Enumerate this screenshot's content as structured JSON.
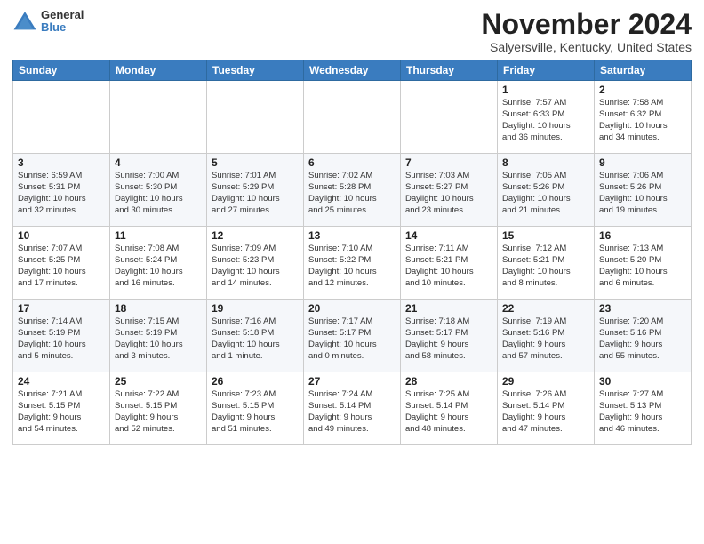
{
  "header": {
    "logo": {
      "general": "General",
      "blue": "Blue"
    },
    "title": "November 2024",
    "location": "Salyersville, Kentucky, United States"
  },
  "days_of_week": [
    "Sunday",
    "Monday",
    "Tuesday",
    "Wednesday",
    "Thursday",
    "Friday",
    "Saturday"
  ],
  "weeks": [
    [
      {
        "day": "",
        "info": ""
      },
      {
        "day": "",
        "info": ""
      },
      {
        "day": "",
        "info": ""
      },
      {
        "day": "",
        "info": ""
      },
      {
        "day": "",
        "info": ""
      },
      {
        "day": "1",
        "info": "Sunrise: 7:57 AM\nSunset: 6:33 PM\nDaylight: 10 hours\nand 36 minutes."
      },
      {
        "day": "2",
        "info": "Sunrise: 7:58 AM\nSunset: 6:32 PM\nDaylight: 10 hours\nand 34 minutes."
      }
    ],
    [
      {
        "day": "3",
        "info": "Sunrise: 6:59 AM\nSunset: 5:31 PM\nDaylight: 10 hours\nand 32 minutes."
      },
      {
        "day": "4",
        "info": "Sunrise: 7:00 AM\nSunset: 5:30 PM\nDaylight: 10 hours\nand 30 minutes."
      },
      {
        "day": "5",
        "info": "Sunrise: 7:01 AM\nSunset: 5:29 PM\nDaylight: 10 hours\nand 27 minutes."
      },
      {
        "day": "6",
        "info": "Sunrise: 7:02 AM\nSunset: 5:28 PM\nDaylight: 10 hours\nand 25 minutes."
      },
      {
        "day": "7",
        "info": "Sunrise: 7:03 AM\nSunset: 5:27 PM\nDaylight: 10 hours\nand 23 minutes."
      },
      {
        "day": "8",
        "info": "Sunrise: 7:05 AM\nSunset: 5:26 PM\nDaylight: 10 hours\nand 21 minutes."
      },
      {
        "day": "9",
        "info": "Sunrise: 7:06 AM\nSunset: 5:26 PM\nDaylight: 10 hours\nand 19 minutes."
      }
    ],
    [
      {
        "day": "10",
        "info": "Sunrise: 7:07 AM\nSunset: 5:25 PM\nDaylight: 10 hours\nand 17 minutes."
      },
      {
        "day": "11",
        "info": "Sunrise: 7:08 AM\nSunset: 5:24 PM\nDaylight: 10 hours\nand 16 minutes."
      },
      {
        "day": "12",
        "info": "Sunrise: 7:09 AM\nSunset: 5:23 PM\nDaylight: 10 hours\nand 14 minutes."
      },
      {
        "day": "13",
        "info": "Sunrise: 7:10 AM\nSunset: 5:22 PM\nDaylight: 10 hours\nand 12 minutes."
      },
      {
        "day": "14",
        "info": "Sunrise: 7:11 AM\nSunset: 5:21 PM\nDaylight: 10 hours\nand 10 minutes."
      },
      {
        "day": "15",
        "info": "Sunrise: 7:12 AM\nSunset: 5:21 PM\nDaylight: 10 hours\nand 8 minutes."
      },
      {
        "day": "16",
        "info": "Sunrise: 7:13 AM\nSunset: 5:20 PM\nDaylight: 10 hours\nand 6 minutes."
      }
    ],
    [
      {
        "day": "17",
        "info": "Sunrise: 7:14 AM\nSunset: 5:19 PM\nDaylight: 10 hours\nand 5 minutes."
      },
      {
        "day": "18",
        "info": "Sunrise: 7:15 AM\nSunset: 5:19 PM\nDaylight: 10 hours\nand 3 minutes."
      },
      {
        "day": "19",
        "info": "Sunrise: 7:16 AM\nSunset: 5:18 PM\nDaylight: 10 hours\nand 1 minute."
      },
      {
        "day": "20",
        "info": "Sunrise: 7:17 AM\nSunset: 5:17 PM\nDaylight: 10 hours\nand 0 minutes."
      },
      {
        "day": "21",
        "info": "Sunrise: 7:18 AM\nSunset: 5:17 PM\nDaylight: 9 hours\nand 58 minutes."
      },
      {
        "day": "22",
        "info": "Sunrise: 7:19 AM\nSunset: 5:16 PM\nDaylight: 9 hours\nand 57 minutes."
      },
      {
        "day": "23",
        "info": "Sunrise: 7:20 AM\nSunset: 5:16 PM\nDaylight: 9 hours\nand 55 minutes."
      }
    ],
    [
      {
        "day": "24",
        "info": "Sunrise: 7:21 AM\nSunset: 5:15 PM\nDaylight: 9 hours\nand 54 minutes."
      },
      {
        "day": "25",
        "info": "Sunrise: 7:22 AM\nSunset: 5:15 PM\nDaylight: 9 hours\nand 52 minutes."
      },
      {
        "day": "26",
        "info": "Sunrise: 7:23 AM\nSunset: 5:15 PM\nDaylight: 9 hours\nand 51 minutes."
      },
      {
        "day": "27",
        "info": "Sunrise: 7:24 AM\nSunset: 5:14 PM\nDaylight: 9 hours\nand 49 minutes."
      },
      {
        "day": "28",
        "info": "Sunrise: 7:25 AM\nSunset: 5:14 PM\nDaylight: 9 hours\nand 48 minutes."
      },
      {
        "day": "29",
        "info": "Sunrise: 7:26 AM\nSunset: 5:14 PM\nDaylight: 9 hours\nand 47 minutes."
      },
      {
        "day": "30",
        "info": "Sunrise: 7:27 AM\nSunset: 5:13 PM\nDaylight: 9 hours\nand 46 minutes."
      }
    ]
  ]
}
